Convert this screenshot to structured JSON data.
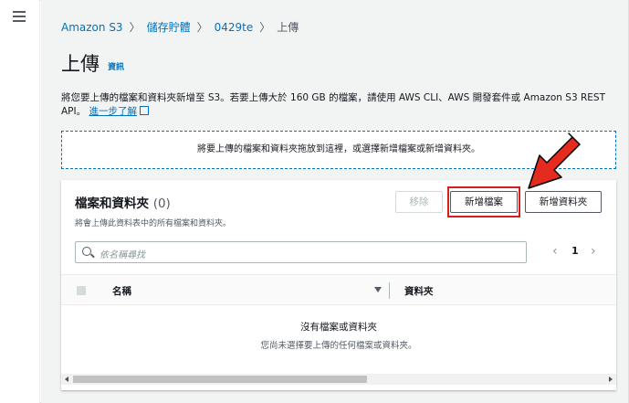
{
  "breadcrumb": {
    "items": [
      "Amazon S3",
      "儲存貯體",
      "0429te"
    ],
    "current": "上傳"
  },
  "page": {
    "title": "上傳",
    "info_label": "資訊",
    "description": "將您要上傳的檔案和資料夾新增至 S3。若要上傳大於 160 GB 的檔案，請使用 AWS CLI、AWS 開發套件或 Amazon S3 REST API。",
    "learn_more": "進一步了解"
  },
  "dropzone": {
    "text": "將要上傳的檔案和資料夾拖放到這裡，或選擇新增檔案或新增資料夾。"
  },
  "panel": {
    "title": "檔案和資料夾",
    "count": "(0)",
    "subtitle": "將會上傳此資料表中的所有檔案和資料夾。",
    "buttons": {
      "remove": "移除",
      "add_files": "新增檔案",
      "add_folder": "新增資料夾"
    },
    "search_placeholder": "依名稱尋找",
    "pagination": {
      "current_page": "1"
    },
    "columns": {
      "name": "名稱",
      "folder": "資料夾"
    },
    "empty": {
      "title": "沒有檔案或資料夾",
      "subtitle": "您尚未選擇要上傳的任何檔案或資料夾。"
    }
  },
  "colors": {
    "link": "#0073bb",
    "highlight": "#d91c1c",
    "background": "#f2f3f3"
  },
  "icons": [
    "menu-icon",
    "chevron-right-icon",
    "external-link-icon",
    "search-icon",
    "chevron-left-icon",
    "sort-down-icon",
    "red-arrow-icon"
  ]
}
